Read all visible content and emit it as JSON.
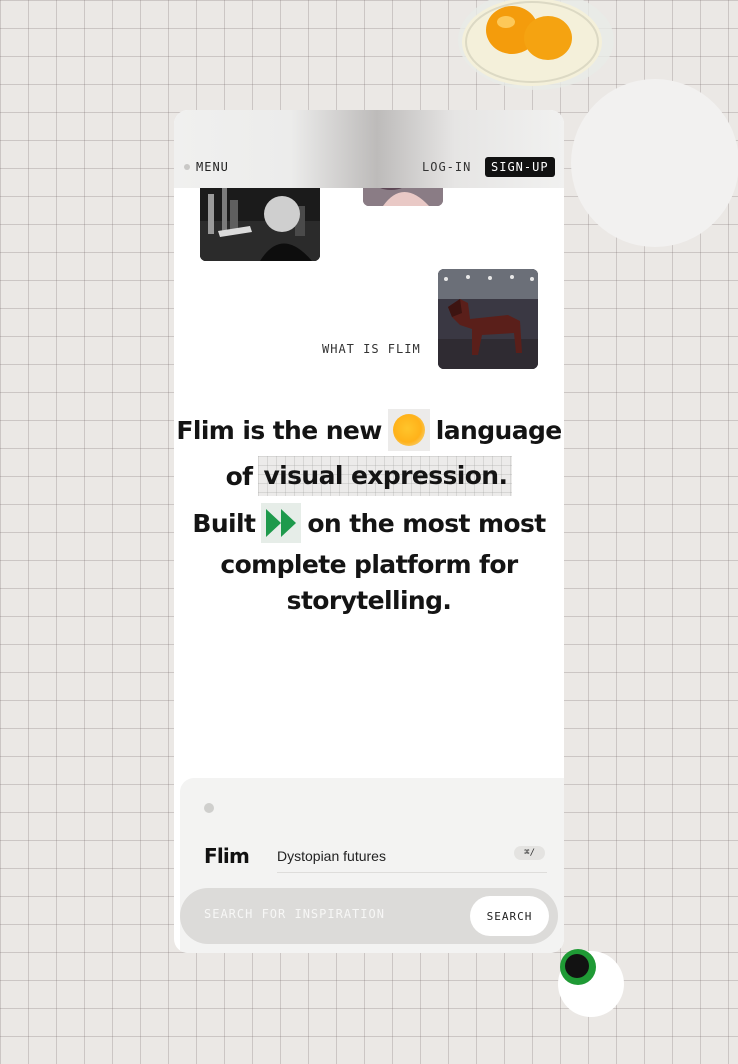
{
  "nav": {
    "menu_label": "MENU",
    "login_label": "LOG-IN",
    "signup_label": "SIGN-UP"
  },
  "intro": {
    "what_is_label": "WHAT IS FLIM"
  },
  "headline": {
    "line1_a": "Flim is the new",
    "line1_b": "language",
    "line2_a": "of",
    "line2_b": "visual expression.",
    "line3_a": "Built",
    "line3_b": "on the most most",
    "line4": "complete platform for",
    "line5": "storytelling."
  },
  "search": {
    "logo": "Flim",
    "query": "Dystopian futures",
    "shortcut": "⌘/",
    "placeholder": "SEARCH FOR INSPIRATION",
    "button_label": "SEARCH"
  },
  "icons": {
    "sun": "sun-icon",
    "fast_forward": "fast-forward-icon",
    "menu": "menu-dot-icon"
  },
  "colors": {
    "accent_green": "#1e9a4c",
    "accent_yellow": "#ffb21a",
    "signup_bg": "#111111",
    "background": "#ebe8e5"
  }
}
